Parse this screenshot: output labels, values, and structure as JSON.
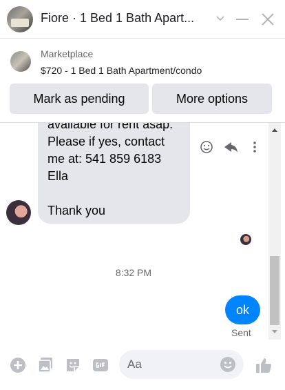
{
  "header": {
    "title": "Fiore · 1 Bed 1 Bath Apart..."
  },
  "marketplace": {
    "label": "Marketplace",
    "listing": "$720 - 1 Bed 1 Bath Apartment/condo",
    "mark_pending_label": "Mark as pending",
    "more_options_label": "More options"
  },
  "conversation": {
    "incoming_lines": [
      "available for rent asap.",
      "Please if yes, contact",
      "me at: 541 859 6183",
      "Ella",
      "",
      "Thank you"
    ],
    "timestamp": "8:32 PM",
    "outgoing_message": "ok",
    "outgoing_status": "Sent"
  },
  "composer": {
    "placeholder": "Aa"
  },
  "icons": [
    "minimize-icon",
    "close-icon",
    "chevron-down-icon",
    "emoji-react-icon",
    "reply-icon",
    "more-vertical-icon",
    "plus-icon",
    "photo-icon",
    "sticker-icon",
    "gif-icon",
    "emoji-icon",
    "like-icon"
  ],
  "colors": {
    "accent": "#0084ff",
    "bubble_incoming": "#e4e6eb",
    "icon_gray": "#bcc0c4",
    "text_secondary": "#65676b"
  }
}
